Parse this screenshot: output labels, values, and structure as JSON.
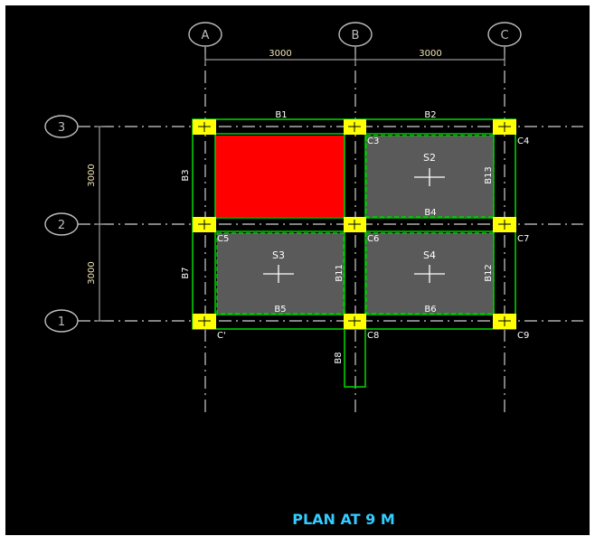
{
  "plan_title": "PLAN AT 9 M",
  "grid_columns": [
    "A",
    "B",
    "C"
  ],
  "grid_rows": [
    "3",
    "2",
    "1"
  ],
  "horizontal_dimensions": [
    "3000",
    "3000"
  ],
  "vertical_dimensions": [
    "3000",
    "3000"
  ],
  "beams": {
    "b1": "B1",
    "b2": "B2",
    "b3": "B3",
    "b4": "B4",
    "b5": "B5",
    "b6": "B6",
    "b7": "B7",
    "b8": "B8",
    "b11": "B11",
    "b12": "B12",
    "b13": "B13"
  },
  "columns": {
    "c3": "C3",
    "c4": "C4",
    "c5": "C5",
    "c6": "C6",
    "c7": "C7",
    "c8": "C8",
    "c9": "C9",
    "c1": "C'"
  },
  "slabs": {
    "s2": "S2",
    "s3": "S3",
    "s4": "S4"
  },
  "colors": {
    "background": "#000000",
    "beam_outline": "#00cc00",
    "column_fill": "#ffff00",
    "slab_fill": "#5a5a5a",
    "highlight_slab": "#ff0000",
    "title": "#33ccff",
    "label": "#ffffff"
  }
}
